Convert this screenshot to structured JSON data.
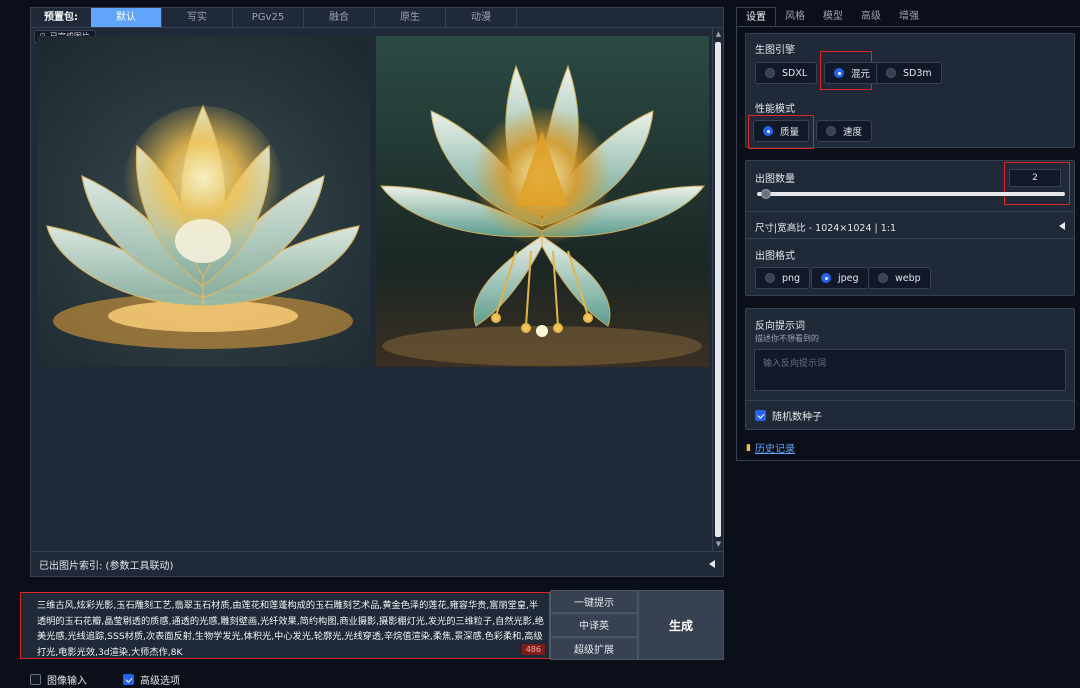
{
  "preset": {
    "label": "预置包:",
    "tabs": [
      "默认",
      "写实",
      "PGv25",
      "融合",
      "原生",
      "动漫"
    ],
    "active_index": 0
  },
  "gallery": {
    "badge": "已完成图片",
    "images": [
      "lotus-image-1",
      "lotus-image-2"
    ],
    "index_label": "已出图片索引: (参数工具联动)"
  },
  "prompt": {
    "text": "三维古风,炫彩光影,玉石雕刻工艺,翡翠玉石材质,由莲花和莲蓬构成的玉石雕刻艺术品,黄金色泽的莲花,雍容华贵,富丽堂皇,半透明的玉石花瓣,晶莹剔透的质感,通透的光感,雕刻壁画,光纤效果,简约构图,商业摄影,摄影棚灯光,发光的三维粒子,自然光影,绝美光感,光线追踪,SSS材质,次表面反射,生物学发光,体积光,中心发光,轮廓光,光线穿透,辛烷值渲染,柔焦,景深感,色彩柔和,高级打光,电影光效,3d渲染,大师杰作,8K",
    "count": "486"
  },
  "actions": {
    "one_click": "一键提示",
    "translate": "中译英",
    "expand": "超级扩展",
    "generate": "生成"
  },
  "bottom": {
    "image_input": "图像输入",
    "advanced": "高级选项",
    "image_input_checked": false,
    "advanced_checked": true
  },
  "right_tabs": [
    "设置",
    "风格",
    "模型",
    "高级",
    "增强"
  ],
  "settings": {
    "engine_title": "生图引擎",
    "engines": [
      "SDXL",
      "混元",
      "SD3m"
    ],
    "engine_selected": 1,
    "perf_title": "性能模式",
    "perf_modes": [
      "质量",
      "速度"
    ],
    "perf_selected": 0,
    "count_title": "出图数量",
    "count_value": "2",
    "size_label": "尺寸|宽高比 - 1024×1024 | 1:1",
    "format_title": "出图格式",
    "formats": [
      "png",
      "jpeg",
      "webp"
    ],
    "format_selected": 1,
    "neg_title": "反向提示词",
    "neg_sub": "描述你不想看到的",
    "neg_placeholder": "输入反向提示词",
    "random_seed": "随机数种子",
    "history": "历史记录"
  },
  "colors": {
    "accent": "#60a5fa",
    "highlight": "#dc2626",
    "background": "#0b0f19"
  }
}
